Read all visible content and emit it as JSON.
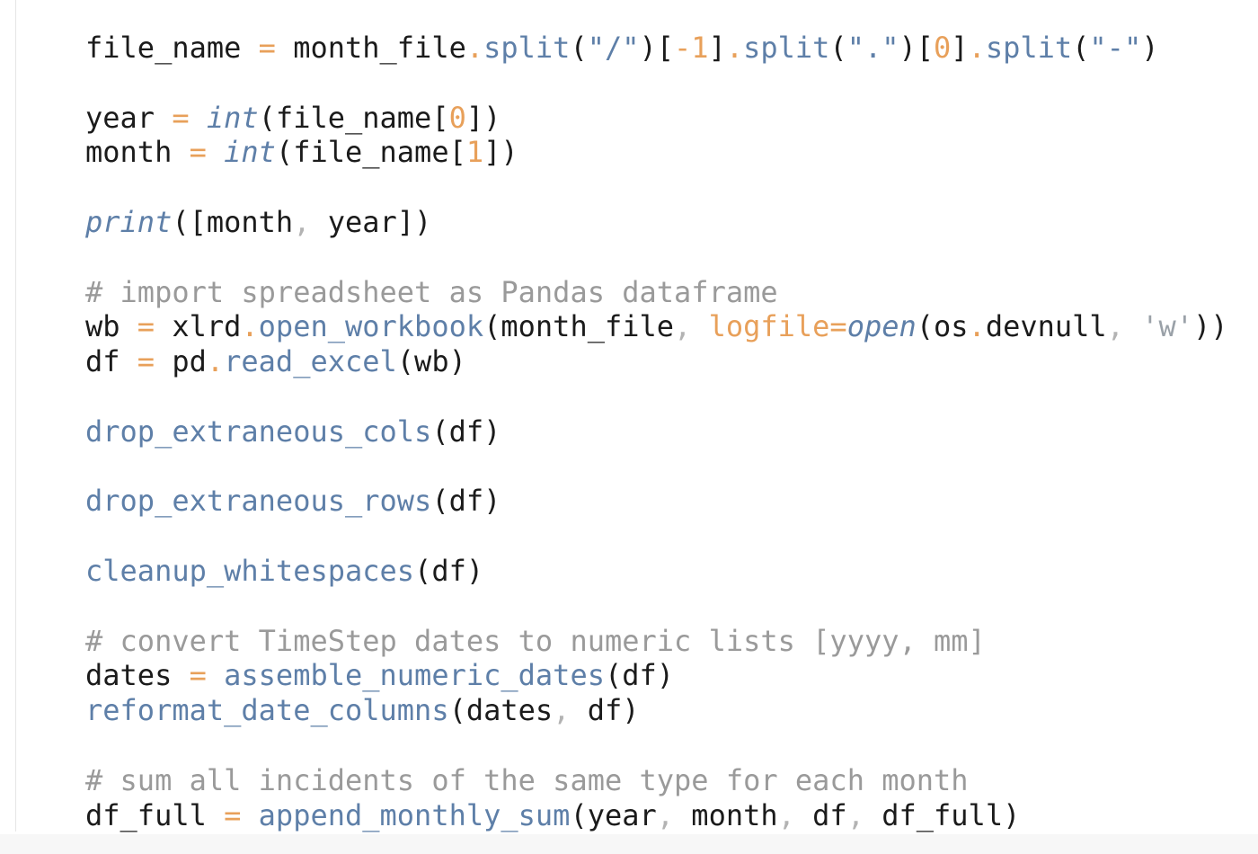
{
  "editor": {
    "lines": [
      {
        "tokens": [
          {
            "t": "id",
            "s": "file_name"
          },
          {
            "t": "p",
            "s": " "
          },
          {
            "t": "op",
            "s": "="
          },
          {
            "t": "p",
            "s": " "
          },
          {
            "t": "id",
            "s": "month_file"
          },
          {
            "t": "op",
            "s": "."
          },
          {
            "t": "fn",
            "s": "split"
          },
          {
            "t": "p",
            "s": "("
          },
          {
            "t": "str",
            "s": "\"/\""
          },
          {
            "t": "p",
            "s": ")["
          },
          {
            "t": "num",
            "s": "-1"
          },
          {
            "t": "p",
            "s": "]"
          },
          {
            "t": "op",
            "s": "."
          },
          {
            "t": "fn",
            "s": "split"
          },
          {
            "t": "p",
            "s": "("
          },
          {
            "t": "str",
            "s": "\".\""
          },
          {
            "t": "p",
            "s": ")["
          },
          {
            "t": "num",
            "s": "0"
          },
          {
            "t": "p",
            "s": "]"
          },
          {
            "t": "op",
            "s": "."
          },
          {
            "t": "fn",
            "s": "split"
          },
          {
            "t": "p",
            "s": "("
          },
          {
            "t": "str",
            "s": "\"-\""
          },
          {
            "t": "p",
            "s": ")"
          }
        ]
      },
      {
        "tokens": []
      },
      {
        "tokens": [
          {
            "t": "id",
            "s": "year"
          },
          {
            "t": "p",
            "s": " "
          },
          {
            "t": "op",
            "s": "="
          },
          {
            "t": "p",
            "s": " "
          },
          {
            "t": "bi",
            "s": "int"
          },
          {
            "t": "p",
            "s": "(file_name["
          },
          {
            "t": "num",
            "s": "0"
          },
          {
            "t": "p",
            "s": "])"
          }
        ]
      },
      {
        "tokens": [
          {
            "t": "id",
            "s": "month"
          },
          {
            "t": "p",
            "s": " "
          },
          {
            "t": "op",
            "s": "="
          },
          {
            "t": "p",
            "s": " "
          },
          {
            "t": "bi",
            "s": "int"
          },
          {
            "t": "p",
            "s": "(file_name["
          },
          {
            "t": "num",
            "s": "1"
          },
          {
            "t": "p",
            "s": "])"
          }
        ]
      },
      {
        "tokens": []
      },
      {
        "tokens": [
          {
            "t": "bi",
            "s": "print"
          },
          {
            "t": "p",
            "s": "([month"
          },
          {
            "t": "pd",
            "s": ","
          },
          {
            "t": "p",
            "s": " year])"
          }
        ]
      },
      {
        "tokens": []
      },
      {
        "tokens": [
          {
            "t": "cm",
            "s": "# import spreadsheet as Pandas dataframe"
          }
        ]
      },
      {
        "tokens": [
          {
            "t": "id",
            "s": "wb"
          },
          {
            "t": "p",
            "s": " "
          },
          {
            "t": "op",
            "s": "="
          },
          {
            "t": "p",
            "s": " "
          },
          {
            "t": "id",
            "s": "xlrd"
          },
          {
            "t": "op",
            "s": "."
          },
          {
            "t": "fn",
            "s": "open_workbook"
          },
          {
            "t": "p",
            "s": "(month_file"
          },
          {
            "t": "pd",
            "s": ","
          },
          {
            "t": "p",
            "s": " "
          },
          {
            "t": "kw",
            "s": "logfile"
          },
          {
            "t": "op",
            "s": "="
          },
          {
            "t": "bi",
            "s": "open"
          },
          {
            "t": "p",
            "s": "(os"
          },
          {
            "t": "op",
            "s": "."
          },
          {
            "t": "id",
            "s": "devnull"
          },
          {
            "t": "pd",
            "s": ","
          },
          {
            "t": "p",
            "s": " "
          },
          {
            "t": "sstr",
            "s": "'w'"
          },
          {
            "t": "p",
            "s": "))"
          }
        ]
      },
      {
        "tokens": [
          {
            "t": "id",
            "s": "df"
          },
          {
            "t": "p",
            "s": " "
          },
          {
            "t": "op",
            "s": "="
          },
          {
            "t": "p",
            "s": " "
          },
          {
            "t": "id",
            "s": "pd"
          },
          {
            "t": "op",
            "s": "."
          },
          {
            "t": "fn",
            "s": "read_excel"
          },
          {
            "t": "p",
            "s": "(wb)"
          }
        ]
      },
      {
        "tokens": []
      },
      {
        "tokens": [
          {
            "t": "fn",
            "s": "drop_extraneous_cols"
          },
          {
            "t": "p",
            "s": "(df)"
          }
        ]
      },
      {
        "tokens": []
      },
      {
        "tokens": [
          {
            "t": "fn",
            "s": "drop_extraneous_rows"
          },
          {
            "t": "p",
            "s": "(df)"
          }
        ]
      },
      {
        "tokens": []
      },
      {
        "tokens": [
          {
            "t": "fn",
            "s": "cleanup_whitespaces"
          },
          {
            "t": "p",
            "s": "(df)"
          }
        ]
      },
      {
        "tokens": []
      },
      {
        "tokens": [
          {
            "t": "cm",
            "s": "# convert TimeStep dates to numeric lists [yyyy, mm]"
          }
        ]
      },
      {
        "tokens": [
          {
            "t": "id",
            "s": "dates"
          },
          {
            "t": "p",
            "s": " "
          },
          {
            "t": "op",
            "s": "="
          },
          {
            "t": "p",
            "s": " "
          },
          {
            "t": "fn",
            "s": "assemble_numeric_dates"
          },
          {
            "t": "p",
            "s": "(df)"
          }
        ]
      },
      {
        "tokens": [
          {
            "t": "fn",
            "s": "reformat_date_columns"
          },
          {
            "t": "p",
            "s": "(dates"
          },
          {
            "t": "pd",
            "s": ","
          },
          {
            "t": "p",
            "s": " df)"
          }
        ]
      },
      {
        "tokens": []
      },
      {
        "tokens": [
          {
            "t": "cm",
            "s": "# sum all incidents of the same type for each month"
          }
        ]
      },
      {
        "tokens": [
          {
            "t": "id",
            "s": "df_full"
          },
          {
            "t": "p",
            "s": " "
          },
          {
            "t": "op",
            "s": "="
          },
          {
            "t": "p",
            "s": " "
          },
          {
            "t": "fn",
            "s": "append_monthly_sum"
          },
          {
            "t": "p",
            "s": "(year"
          },
          {
            "t": "pd",
            "s": ","
          },
          {
            "t": "p",
            "s": " month"
          },
          {
            "t": "pd",
            "s": ","
          },
          {
            "t": "p",
            "s": " df"
          },
          {
            "t": "pd",
            "s": ","
          },
          {
            "t": "p",
            "s": " df_full)"
          }
        ]
      }
    ]
  }
}
